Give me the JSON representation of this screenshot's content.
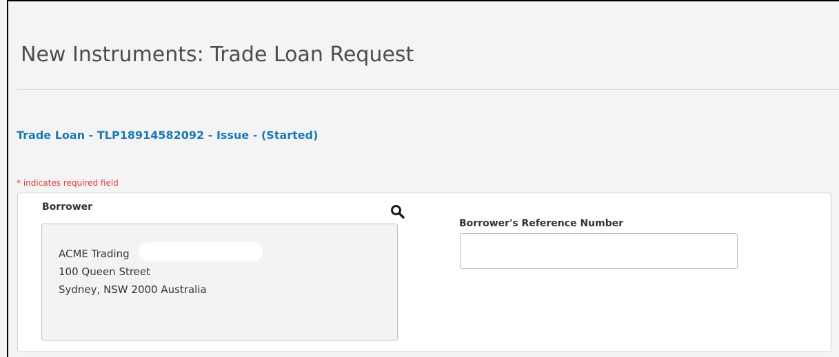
{
  "page": {
    "title": "New Instruments: Trade Loan Request"
  },
  "transaction": {
    "heading": "Trade Loan - TLP18914582092 - Issue - (Started)"
  },
  "form": {
    "required_note": "* indicates required field",
    "borrower": {
      "label": "Borrower",
      "search_icon": "search-icon",
      "address_lines": [
        "ACME Trading",
        "100 Queen Street",
        "Sydney, NSW 2000 Australia"
      ]
    },
    "borrower_reference": {
      "label": "Borrower's Reference Number",
      "value": "",
      "placeholder": ""
    }
  },
  "colors": {
    "accent_blue": "#1978b8",
    "required_red": "#e03a3a",
    "title_gray": "#4d4d4d",
    "page_bg": "#f4f4f4"
  }
}
